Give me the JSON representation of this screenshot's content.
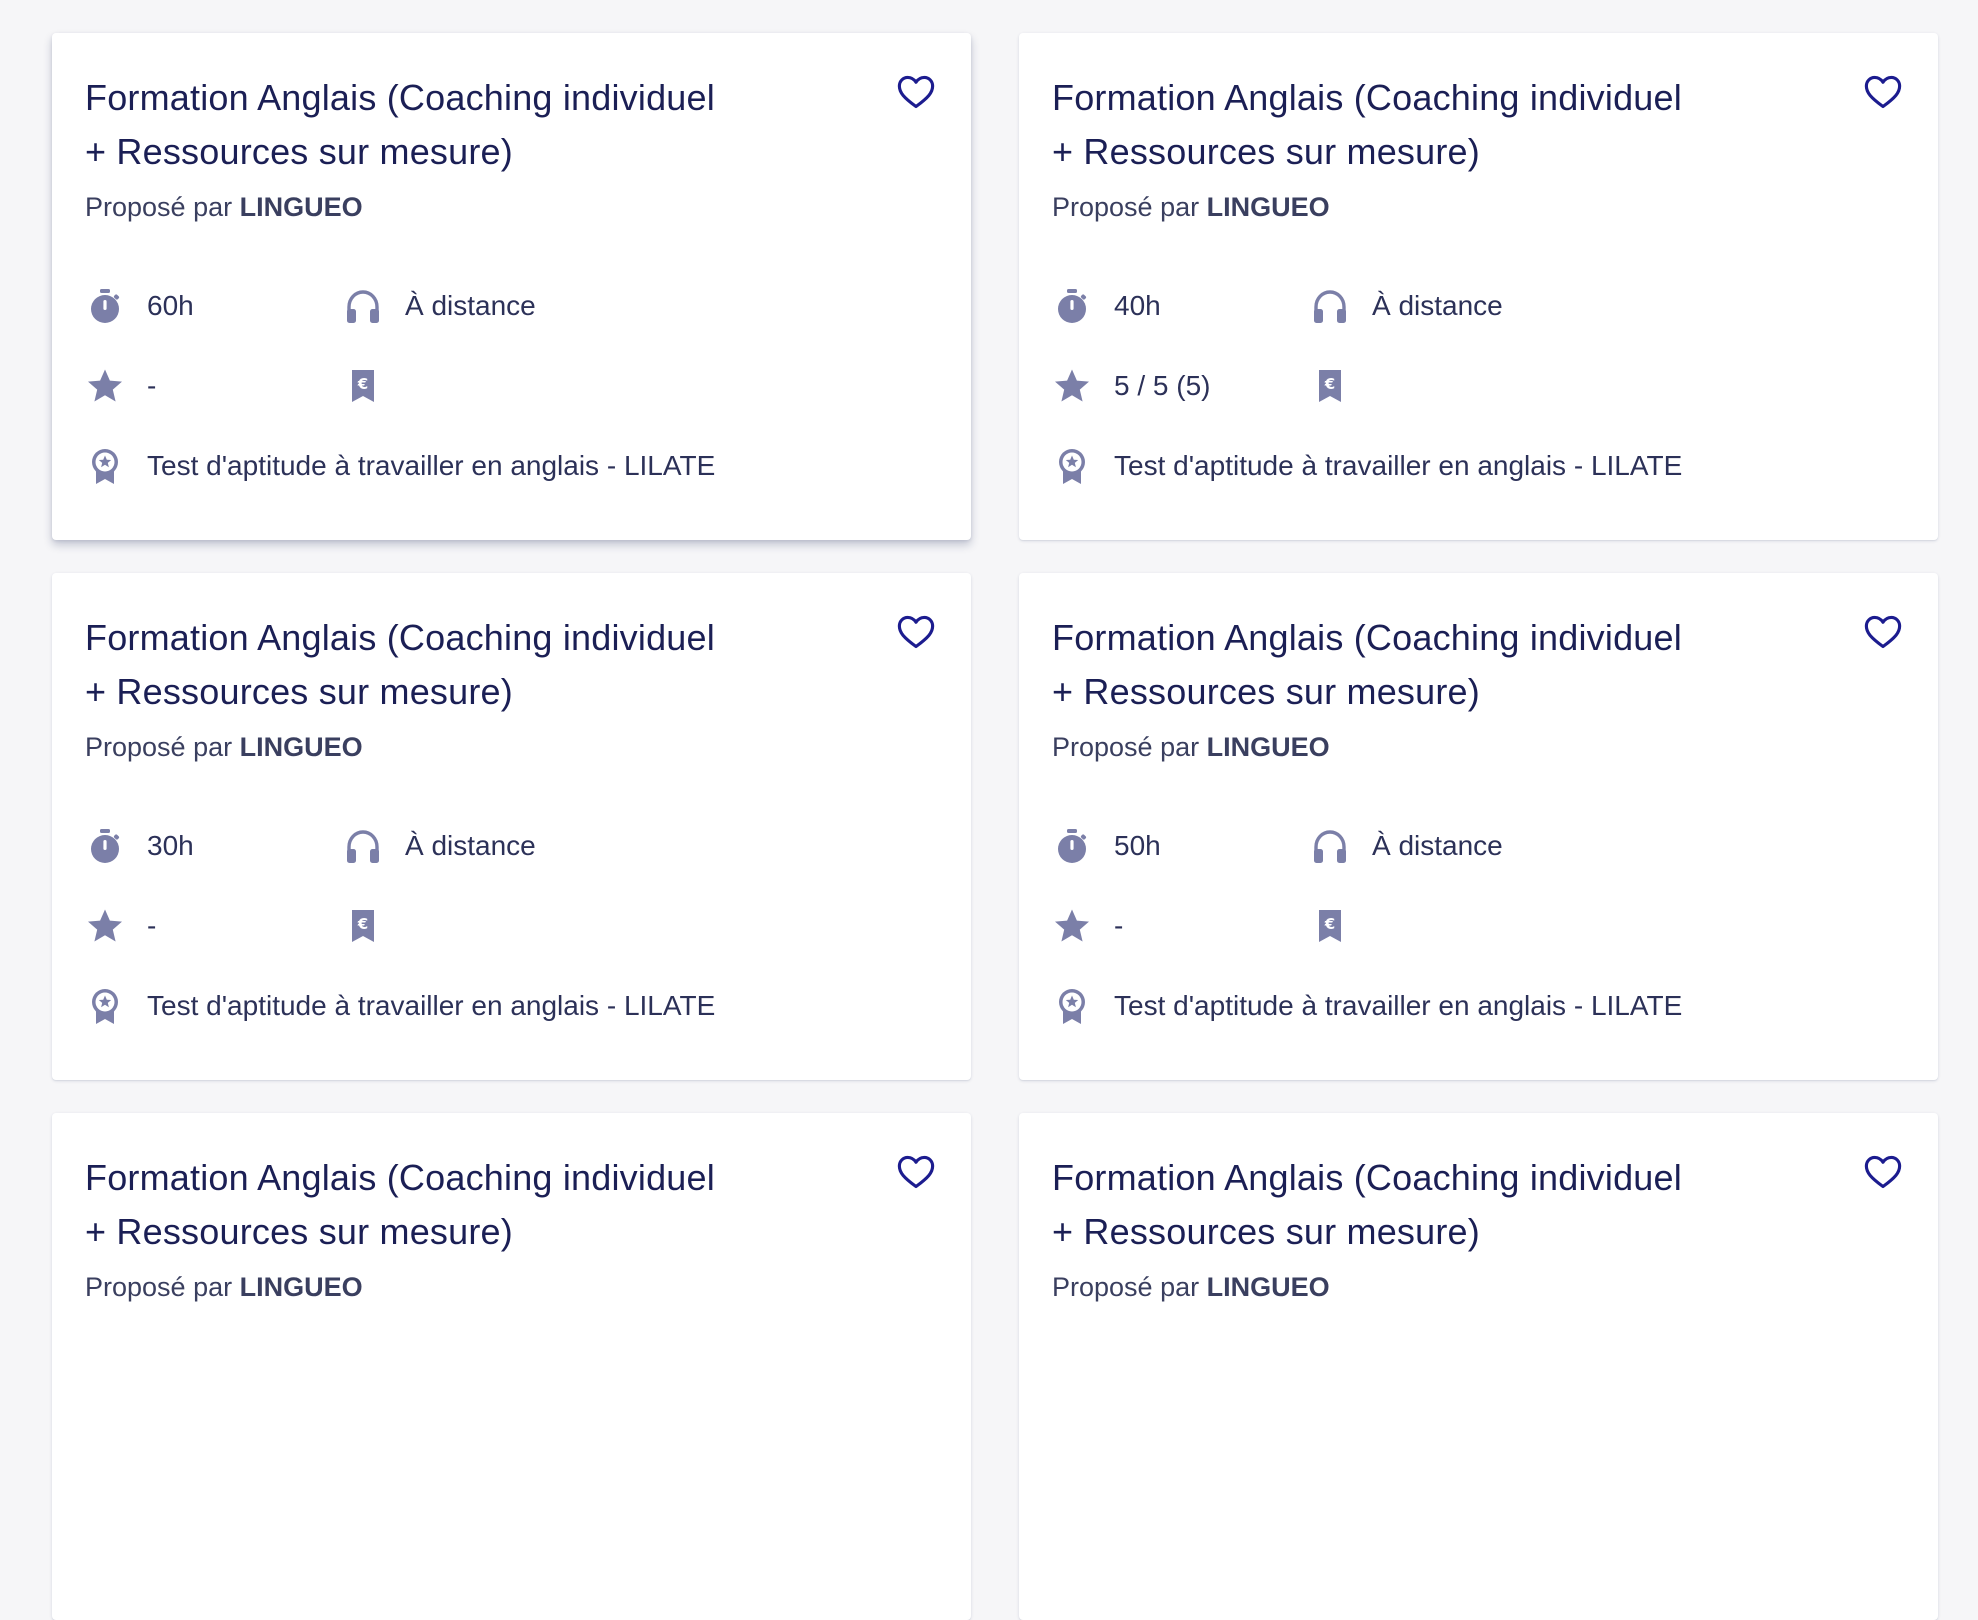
{
  "colors": {
    "accent": "#000091",
    "icon": "#6a6af4",
    "icon_grey": "#7b7fa8",
    "text": "#1b1f55"
  },
  "provider_prefix": "Proposé par",
  "cards": [
    {
      "title_line1": "Formation Anglais (Coaching individuel",
      "title_line2": "+ Ressources sur mesure)",
      "provider": "LINGUEO",
      "duration": "60h",
      "mode": "À distance",
      "rating": "-",
      "price": "",
      "certification": "Test d'aptitude à travailler en anglais - LILATE"
    },
    {
      "title_line1": "Formation Anglais (Coaching individuel",
      "title_line2": "+ Ressources sur mesure)",
      "provider": "LINGUEO",
      "duration": "40h",
      "mode": "À distance",
      "rating": "5 / 5 (5)",
      "price": "",
      "certification": "Test d'aptitude à travailler en anglais - LILATE"
    },
    {
      "title_line1": "Formation Anglais (Coaching individuel",
      "title_line2": "+ Ressources sur mesure)",
      "provider": "LINGUEO",
      "duration": "30h",
      "mode": "À distance",
      "rating": "-",
      "price": "",
      "certification": "Test d'aptitude à travailler en anglais - LILATE"
    },
    {
      "title_line1": "Formation Anglais (Coaching individuel",
      "title_line2": "+ Ressources sur mesure)",
      "provider": "LINGUEO",
      "duration": "50h",
      "mode": "À distance",
      "rating": "-",
      "price": "",
      "certification": "Test d'aptitude à travailler en anglais - LILATE"
    },
    {
      "title_line1": "Formation Anglais (Coaching individuel",
      "title_line2": "+ Ressources sur mesure)",
      "provider": "LINGUEO"
    },
    {
      "title_line1": "Formation Anglais (Coaching individuel",
      "title_line2": "+ Ressources sur mesure)",
      "provider": "LINGUEO"
    }
  ],
  "icons": {
    "favorite": "heart-icon",
    "duration": "stopwatch-icon",
    "mode": "headphones-icon",
    "rating": "star-icon",
    "price": "euro-tag-icon",
    "certification": "certificate-ribbon-icon"
  }
}
